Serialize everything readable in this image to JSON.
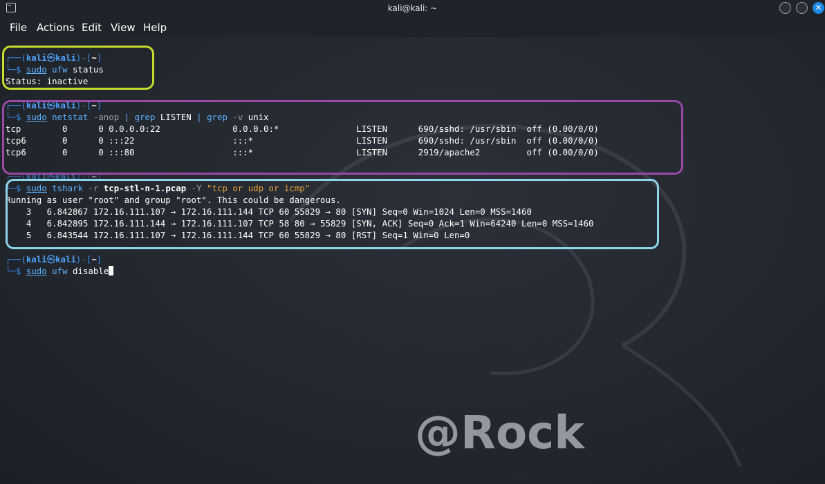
{
  "window": {
    "title": "kali@kali: ~",
    "close_glyph": "✕"
  },
  "menu": [
    "File",
    "Actions",
    "Edit",
    "View",
    "Help"
  ],
  "prompt": {
    "open": "┌──(",
    "user": "kali",
    "skull": "㉿",
    "host": "kali",
    "mid": ")-[",
    "dir": "~",
    "close": "]",
    "arrow": "└─$"
  },
  "blocks": [
    {
      "command": {
        "sudo": "sudo",
        "cmd": "ufw",
        "args": "status"
      },
      "output": [
        "Status: inactive"
      ]
    },
    {
      "command": {
        "sudo": "sudo",
        "cmd": "netstat",
        "opt1": "-anop",
        "pipe1": "|",
        "cmd2": "grep",
        "arg2": "LISTEN",
        "pipe2": "|",
        "cmd3": "grep",
        "opt3": "-v",
        "arg3": "unix"
      },
      "output": [
        "tcp        0      0 0.0.0.0:22              0.0.0.0:*               LISTEN      690/sshd: /usr/sbin  off (0.00/0/0)",
        "tcp6       0      0 :::22                   :::*                    LISTEN      690/sshd: /usr/sbin  off (0.00/0/0)",
        "tcp6       0      0 :::80                   :::*                    LISTEN      2919/apache2         off (0.00/0/0)"
      ]
    },
    {
      "command": {
        "sudo": "sudo",
        "cmd": "tshark",
        "opt1": "-r",
        "file": "tcp-stl-n-1.pcap",
        "opt2": "-Y",
        "filter": "\"tcp or udp or icmp\""
      },
      "output": [
        "Running as user \"root\" and group \"root\". This could be dangerous.",
        "    3   6.842867 172.16.111.107 → 172.16.111.144 TCP 60 55829 → 80 [SYN] Seq=0 Win=1024 Len=0 MSS=1460",
        "    4   6.842895 172.16.111.144 → 172.16.111.107 TCP 58 80 → 55829 [SYN, ACK] Seq=0 Ack=1 Win=64240 Len=0 MSS=1460",
        "    5   6.843544 172.16.111.107 → 172.16.111.144 TCP 60 55829 → 80 [RST] Seq=1 Win=0 Len=0"
      ]
    },
    {
      "command": {
        "sudo": "sudo",
        "cmd": "ufw",
        "args": "disable"
      },
      "output": []
    }
  ],
  "watermark": "@Rock",
  "colors": {
    "highlight_1": "#c6dd2e",
    "highlight_2": "#9a4aa6",
    "highlight_3": "#8fd6ea",
    "accent": "#4ea4ff"
  }
}
